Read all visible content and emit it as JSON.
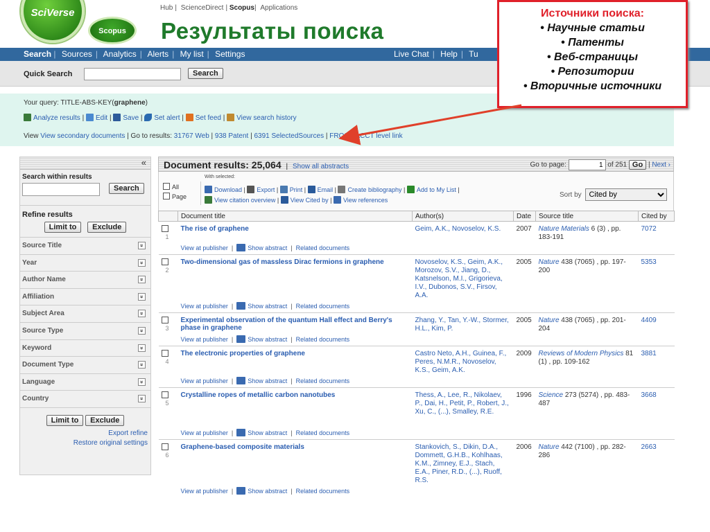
{
  "header": {
    "logo_main": "SciVerse",
    "logo_sub": "Scopus",
    "topnav": [
      "Hub",
      "ScienceDirect",
      "Scopus",
      "Applications"
    ],
    "page_title": "Результаты поиска"
  },
  "navbar": {
    "left": [
      "Search",
      "Sources",
      "Analytics",
      "Alerts",
      "My list",
      "Settings"
    ],
    "right": [
      "Live Chat",
      "Help",
      "Tu"
    ]
  },
  "quick_search": {
    "label": "Quick Search",
    "value": "",
    "button": "Search"
  },
  "query": {
    "prefix": "Your query:",
    "text": "TITLE-ABS-KEY(",
    "term": "graphene",
    "suffix": ")",
    "actions": [
      "Analyze results",
      "Edit",
      "Save",
      "Set alert",
      "Set feed",
      "View search history"
    ],
    "line3_secondary": "View secondary documents",
    "line3_goto": "Go to results:",
    "line3_links": [
      "31767 Web",
      "938 Patent",
      "6391 SelectedSources",
      "FROSH ACCT level link"
    ]
  },
  "callout": {
    "title": "Источники поиска:",
    "items": [
      "• Научные статьи",
      "• Патенты",
      "• Веб-страницы",
      "• Репозитории",
      "• Вторичные источники"
    ]
  },
  "left_panel": {
    "collapse": "«",
    "search_within": "Search within results",
    "search_button": "Search",
    "refine": "Refine results",
    "limit_to": "Limit to",
    "exclude": "Exclude",
    "facets": [
      "Source Title",
      "Year",
      "Author Name",
      "Affiliation",
      "Subject Area",
      "Source Type",
      "Keyword",
      "Document Type",
      "Language",
      "Country"
    ],
    "export_refine": "Export refine",
    "restore": "Restore original settings"
  },
  "results": {
    "title": "Document results: 25,064",
    "show_all": "Show all abstracts",
    "goto_label": "Go to page:",
    "page": "1",
    "of": "of 251",
    "go": "Go",
    "next": "Next ›",
    "all_label": "All",
    "page_label": "Page",
    "with_selected": "With selected:",
    "actions1": [
      "Download",
      "Export",
      "Print",
      "Email",
      "Create bibliography",
      "Add to My List"
    ],
    "actions2": [
      "View citation overview",
      "View Cited by",
      "View references"
    ],
    "sort_label": "Sort by",
    "sort_value": "Cited by",
    "columns": [
      "Document title",
      "Author(s)",
      "Date",
      "Source title",
      "Cited by"
    ],
    "link_publisher": "View at publisher",
    "link_abstract": "Show abstract",
    "link_related": "Related documents",
    "rows": [
      {
        "n": "1",
        "title": "The rise of graphene",
        "authors": "Geim, A.K., Novoselov, K.S.",
        "date": "2007",
        "journal": "Nature Materials",
        "src": " 6 (3) , pp. 183-191",
        "cited": "7072"
      },
      {
        "n": "2",
        "title": "Two-dimensional gas of massless Dirac fermions in graphene",
        "authors": "Novoselov, K.S., Geim, A.K., Morozov, S.V., Jiang, D., Katsnelson, M.I., Grigorieva, I.V., Dubonos, S.V., Firsov, A.A.",
        "date": "2005",
        "journal": "Nature",
        "src": " 438 (7065) , pp. 197-200",
        "cited": "5353"
      },
      {
        "n": "3",
        "title": "Experimental observation of the quantum Hall effect and Berry's phase in graphene",
        "authors": "Zhang, Y., Tan, Y.-W., Stormer, H.L., Kim, P.",
        "date": "2005",
        "journal": "Nature",
        "src": " 438 (7065) , pp. 201-204",
        "cited": "4409"
      },
      {
        "n": "4",
        "title": "The electronic properties of graphene",
        "authors": "Castro Neto, A.H., Guinea, F., Peres, N.M.R., Novoselov, K.S., Geim, A.K.",
        "date": "2009",
        "journal": "Reviews of Modern Physics",
        "src": " 81 (1) , pp. 109-162",
        "cited": "3881"
      },
      {
        "n": "5",
        "title": "Crystalline ropes of metallic carbon nanotubes",
        "authors": "Thess, A., Lee, R., Nikolaev, P., Dai, H., Petit, P., Robert, J., Xu, C., (...), Smalley, R.E.",
        "date": "1996",
        "journal": "Science",
        "src": " 273 (5274) , pp. 483-487",
        "cited": "3668"
      },
      {
        "n": "6",
        "title": "Graphene-based composite materials",
        "authors": "Stankovich, S., Dikin, D.A., Dommett, G.H.B., Kohlhaas, K.M., Zimney, E.J., Stach, E.A., Piner, R.D., (...), Ruoff, R.S.",
        "date": "2006",
        "journal": "Nature",
        "src": " 442 (7100) , pp. 282-286",
        "cited": "2663"
      }
    ]
  },
  "colors": {
    "nav": "#31689e",
    "title_green": "#1f7a2b",
    "callout_red": "#e0202a",
    "query_bg": "#dff5ef",
    "link": "#2a5db0"
  }
}
